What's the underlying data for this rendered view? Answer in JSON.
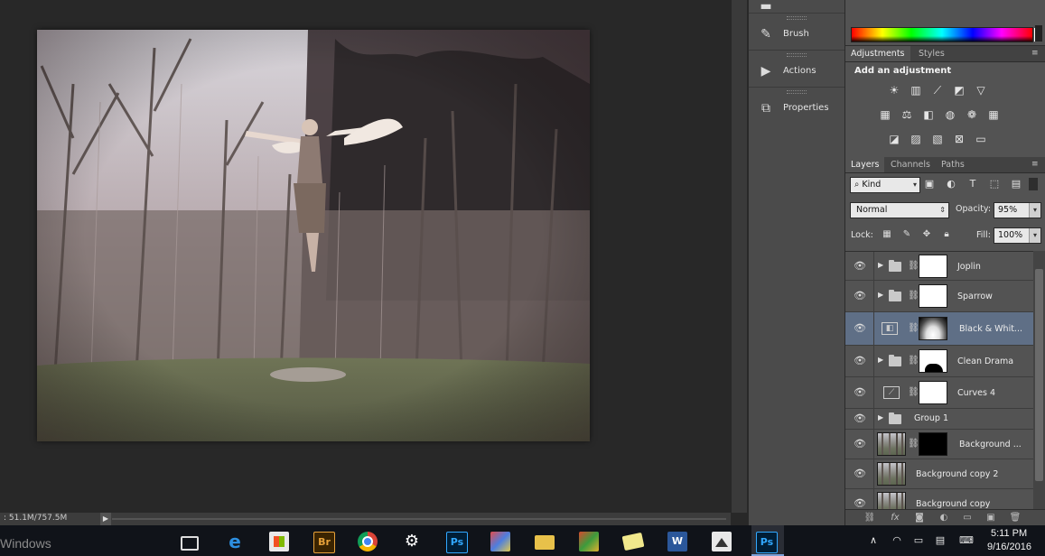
{
  "status_bar": {
    "doc_size": ": 51.1M/757.5M",
    "arrow": "▶"
  },
  "dock": {
    "items": [
      {
        "label": "Brush",
        "icon": "brush-icon"
      },
      {
        "label": "Actions",
        "icon": "actions-play-icon"
      },
      {
        "label": "Properties",
        "icon": "properties-icon"
      }
    ]
  },
  "adjustments_panel": {
    "tabs": [
      "Adjustments",
      "Styles"
    ],
    "title": "Add an adjustment"
  },
  "layers_panel": {
    "tabs": [
      "Layers",
      "Channels",
      "Paths"
    ],
    "filter_kind": "Kind",
    "blend_mode": "Normal",
    "opacity_label": "Opacity:",
    "opacity_value": "95%",
    "lock_label": "Lock:",
    "fill_label": "Fill:",
    "fill_value": "100%",
    "layers": [
      {
        "name": "Joplin",
        "type": "group",
        "mask": "white",
        "expandable": true,
        "selected": false
      },
      {
        "name": "Sparrow",
        "type": "group",
        "mask": "white",
        "expandable": true,
        "selected": false
      },
      {
        "name": "Black & Whit...",
        "type": "adjustment-bw",
        "mask": "bw",
        "expandable": false,
        "selected": true
      },
      {
        "name": "Clean Drama",
        "type": "group",
        "mask": "drama",
        "expandable": true,
        "selected": false
      },
      {
        "name": "Curves 4",
        "type": "adjustment-curves",
        "mask": "white",
        "expandable": false,
        "selected": false
      },
      {
        "name": "Group 1",
        "type": "group",
        "mask": "none",
        "expandable": true,
        "selected": false
      },
      {
        "name": "Background ...",
        "type": "photo",
        "mask": "black",
        "expandable": false,
        "selected": false
      },
      {
        "name": "Background copy 2",
        "type": "photo",
        "mask": "none",
        "expandable": false,
        "selected": false
      },
      {
        "name": "Background copy",
        "type": "photo",
        "mask": "none",
        "expandable": false,
        "selected": false
      }
    ]
  },
  "taskbar": {
    "left_text": "Windows",
    "apps": [
      {
        "icon": "task-view-icon",
        "label": ""
      },
      {
        "icon": "edge-icon",
        "label": "e"
      },
      {
        "icon": "store-icon",
        "label": ""
      },
      {
        "icon": "bridge-icon",
        "label": "Br"
      },
      {
        "icon": "chrome-icon",
        "label": ""
      },
      {
        "icon": "settings-icon",
        "label": "⚙"
      },
      {
        "icon": "photoshop-icon",
        "label": "Ps"
      },
      {
        "icon": "paint-icon",
        "label": ""
      },
      {
        "icon": "file-explorer-icon",
        "label": ""
      },
      {
        "icon": "app-icon",
        "label": ""
      },
      {
        "icon": "sticky-notes-icon",
        "label": ""
      },
      {
        "icon": "word-icon",
        "label": "W"
      },
      {
        "icon": "photos-icon",
        "label": ""
      },
      {
        "icon": "photoshop-active-icon",
        "label": "Ps"
      }
    ],
    "clock_time": "5:11 PM",
    "clock_date": "9/16/2016"
  }
}
